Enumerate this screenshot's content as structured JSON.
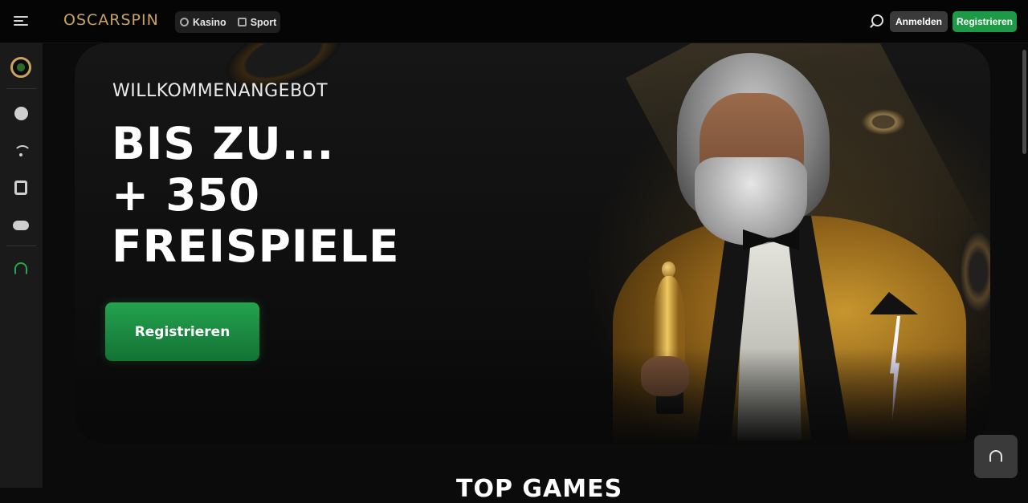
{
  "header": {
    "logo_text": "OSCARSPIN",
    "nav": [
      {
        "label": "Kasino",
        "icon": "casino-chip-icon"
      },
      {
        "label": "Sport",
        "icon": "sport-ticket-icon"
      }
    ],
    "login_label": "Anmelden",
    "register_label": "Registrieren"
  },
  "sidebar": {
    "items": [
      {
        "name": "casino",
        "icon": "chip-icon"
      },
      {
        "name": "live",
        "icon": "live-signal-icon"
      },
      {
        "name": "slots",
        "icon": "slot-machine-icon"
      },
      {
        "name": "games",
        "icon": "gamepad-icon"
      },
      {
        "name": "support",
        "icon": "headset-icon"
      }
    ]
  },
  "hero": {
    "eyebrow": "WILLKOMMENANGEBOT",
    "title_line1": "BIS ZU...",
    "title_line2": "+ 350",
    "title_line3": "FREISPIELE",
    "cta_label": "Registrieren"
  },
  "section": {
    "title": "TOP GAMES"
  },
  "colors": {
    "accent_green": "#1e9a47",
    "brand_gold": "#c9a45c",
    "background": "#0b0b0b"
  }
}
